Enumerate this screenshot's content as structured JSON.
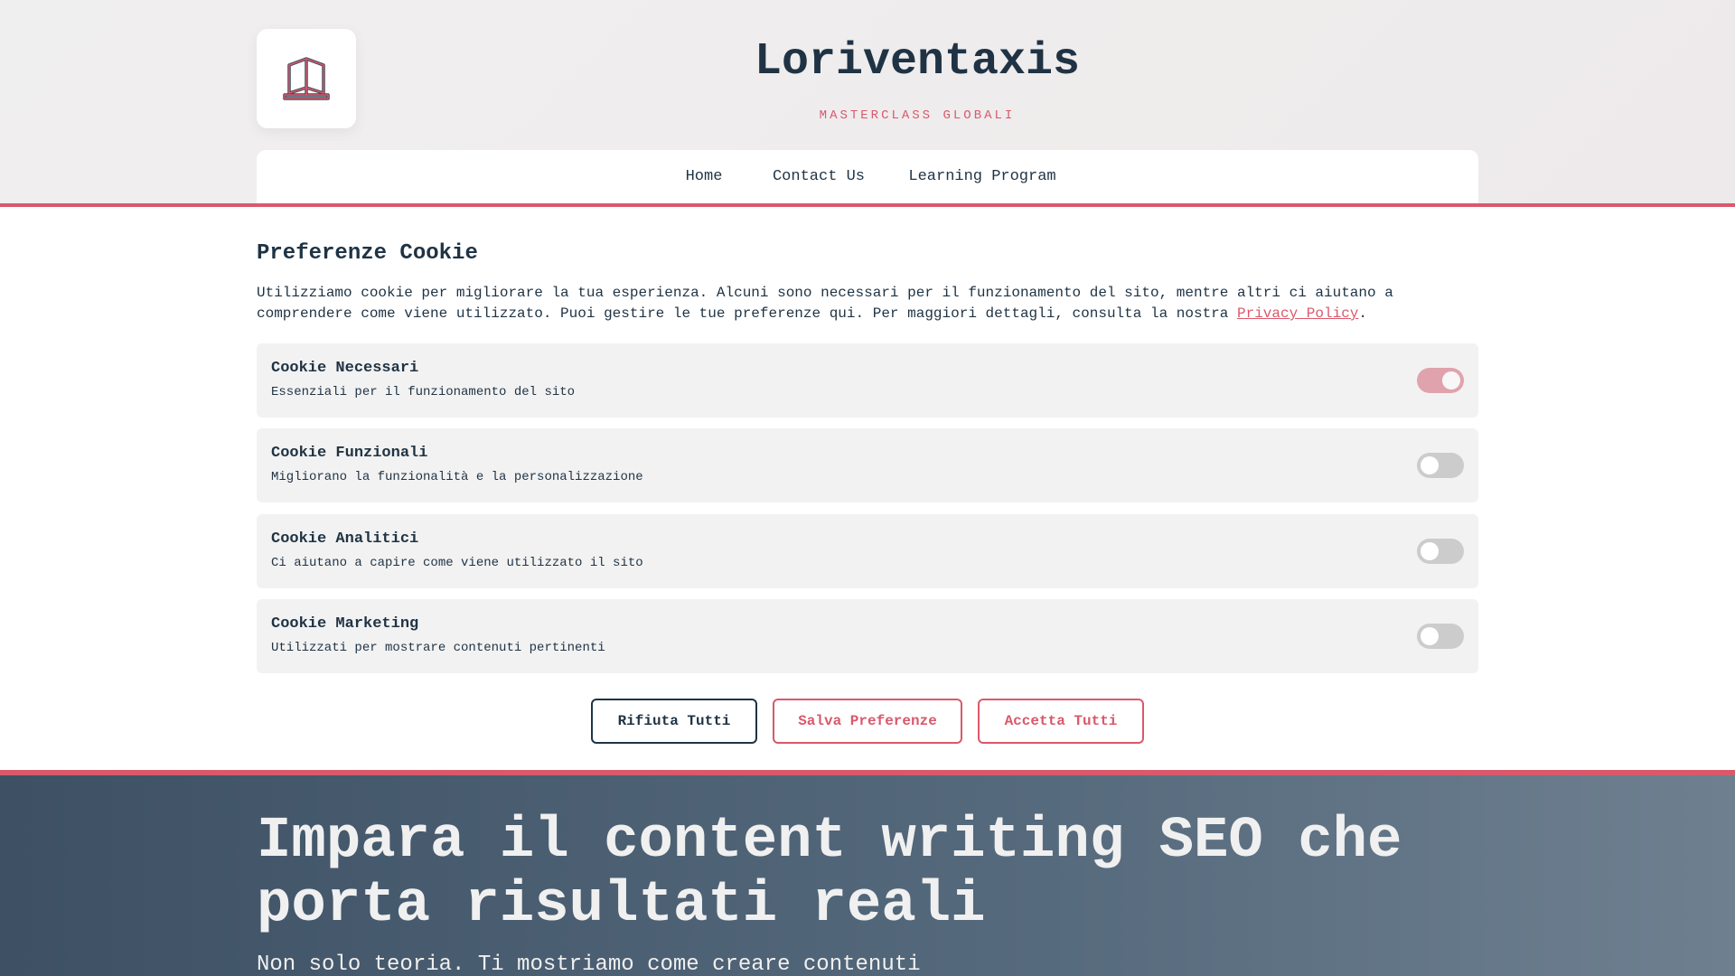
{
  "brand": {
    "title": "Loriventaxis",
    "subtitle": "MASTERCLASS GLOBALI"
  },
  "nav": [
    {
      "label": "Home"
    },
    {
      "label": "Contact Us"
    },
    {
      "label": "Learning Program"
    }
  ],
  "cookie": {
    "heading": "Preferenze Cookie",
    "intro": "Utilizziamo cookie per migliorare la tua esperienza. Alcuni sono necessari per il funzionamento del sito, mentre altri ci aiutano a comprendere come viene utilizzato. Puoi gestire le tue preferenze qui. Per maggiori dettagli, consulta la nostra ",
    "privacy_link": "Privacy Policy",
    "intro_end": ".",
    "categories": [
      {
        "title": "Cookie Necessari",
        "desc": "Essenziali per il funzionamento del sito",
        "enabled": true
      },
      {
        "title": "Cookie Funzionali",
        "desc": "Migliorano la funzionalità e la personalizzazione",
        "enabled": false
      },
      {
        "title": "Cookie Analitici",
        "desc": "Ci aiutano a capire come viene utilizzato il sito",
        "enabled": false
      },
      {
        "title": "Cookie Marketing",
        "desc": "Utilizzati per mostrare contenuti pertinenti",
        "enabled": false
      }
    ],
    "buttons": {
      "reject": "Rifiuta Tutti",
      "save": "Salva Preferenze",
      "accept": "Accetta Tutti"
    }
  },
  "hero": {
    "headline": "Impara il content writing SEO che porta risultati reali",
    "sub": "Non solo teoria. Ti mostriamo come creare contenuti"
  },
  "colors": {
    "accent": "#d9596b",
    "dark": "#1f3344"
  }
}
